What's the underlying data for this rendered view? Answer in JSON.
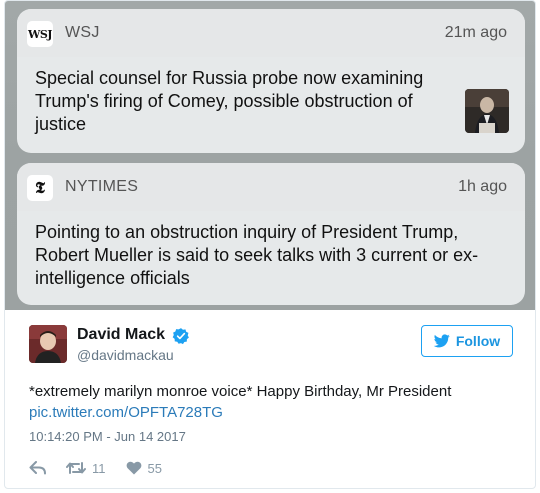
{
  "notifications": [
    {
      "app": "WSJ",
      "icon_text": "WSJ",
      "time": "21m ago",
      "body": "Special counsel for Russia probe now examining Trump's firing of Comey, possible obstruction of justice"
    },
    {
      "app": "NYTIMES",
      "icon_text": "𝕿",
      "time": "1h ago",
      "body": "Pointing to an obstruction inquiry of President Trump, Robert Mueller is said to seek talks with 3 current or ex-intelligence officials"
    }
  ],
  "tweet": {
    "author_name": "David Mack",
    "author_handle": "@davidmackau",
    "follow_label": "Follow",
    "text": "*extremely marilyn monroe voice* Happy Birthday, Mr President",
    "link": "pic.twitter.com/OPFTA728TG",
    "timestamp": "10:14:20 PM - Jun 14 2017",
    "retweets": "11",
    "likes": "55"
  },
  "colors": {
    "accent": "#1da1f2",
    "link": "#2b7bb9",
    "muted": "#657786",
    "action_gray": "#8899a6"
  },
  "icons": [
    "wsj-app-icon",
    "nyt-app-icon",
    "verified-badge-icon",
    "twitter-bird-icon",
    "reply-icon",
    "retweet-icon",
    "heart-icon"
  ]
}
